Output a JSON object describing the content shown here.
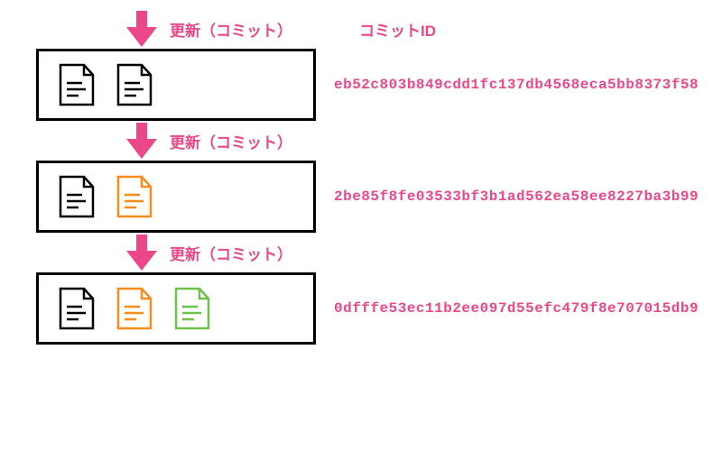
{
  "labels": {
    "commit": "更新（コミット）",
    "header": "コミットID"
  },
  "commits": [
    {
      "hash": "eb52c803b849cdd1fc137db4568eca5bb8373f58"
    },
    {
      "hash": "2be85f8fe03533bf3b1ad562ea58ee8227ba3b99"
    },
    {
      "hash": "0dfffe53ec11b2ee097d55efc479f8e707015db9"
    }
  ],
  "colors": {
    "pink": "#ec4788",
    "black": "#000000",
    "orange": "#f68b1e",
    "green": "#6cc24a"
  }
}
